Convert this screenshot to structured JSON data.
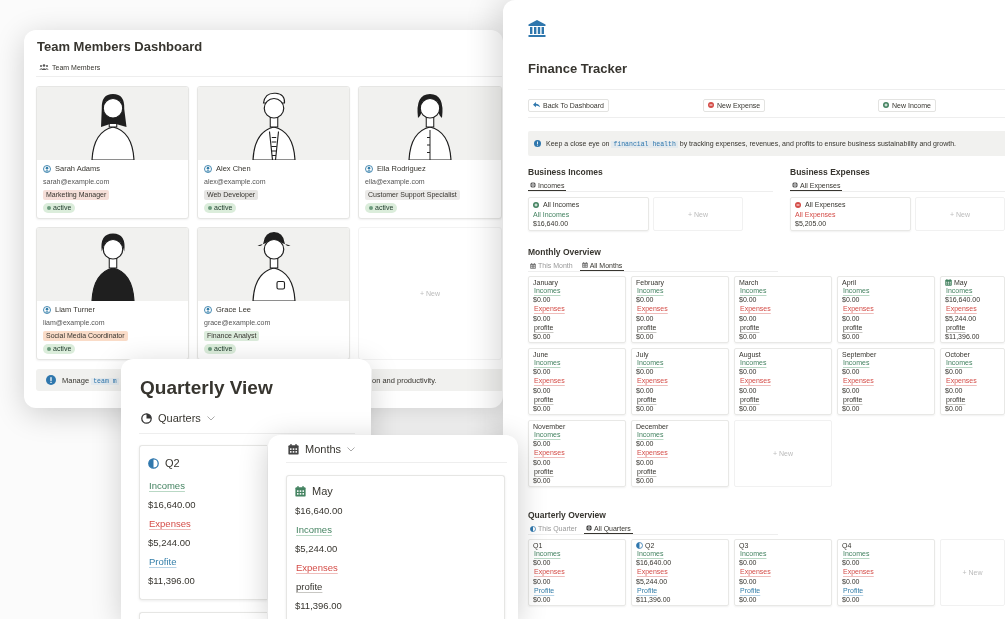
{
  "team_dashboard": {
    "title": "Team Members Dashboard",
    "view_tab": "Team Members",
    "members": [
      {
        "name": "Sarah Adams",
        "email": "sarah@example.com",
        "role": "Marketing Manager",
        "color": "#f6dfd9",
        "status": "active"
      },
      {
        "name": "Alex Chen",
        "email": "alex@example.com",
        "role": "Web Developer",
        "color": "#e6e5e3",
        "status": "active"
      },
      {
        "name": "Ella Rodriguez",
        "email": "ella@example.com",
        "role": "Customer Support Specialist",
        "color": "#ebeae8",
        "status": "active"
      },
      {
        "name": "Liam Turner",
        "email": "liam@example.com",
        "role": "Social Media Coordinator",
        "color": "#fadcc8",
        "status": "active"
      },
      {
        "name": "Grace Lee",
        "email": "grace@example.com",
        "role": "Finance Analyst",
        "color": "#dcecdc",
        "status": "active"
      }
    ],
    "new_card": "+ New",
    "callout": {
      "before": "Manage",
      "code": "team m",
      "after": "on and productivity."
    }
  },
  "finance_tracker": {
    "title": "Finance Tracker",
    "buttons": [
      {
        "label": "Back To Dashboard",
        "kind": "back"
      },
      {
        "label": "New Expense",
        "kind": "expense"
      },
      {
        "label": "New Income",
        "kind": "income"
      }
    ],
    "callout": {
      "before": "Keep a close eye on",
      "code": "financial health",
      "after": "by tracking expenses, revenues, and profits to ensure business sustainability and growth."
    },
    "sections": [
      {
        "kind": "income",
        "title": "Business Incomes",
        "view": "Incomes",
        "card": {
          "title": "All Incomes",
          "label": "All Incomes",
          "value": "$16,640.00"
        },
        "new": "+ New"
      },
      {
        "kind": "expense",
        "title": "Business Expenses",
        "view": "All Expenses",
        "card": {
          "title": "All Expenses",
          "label": "All Expenses",
          "value": "$5,205.00"
        },
        "new": "+ New"
      }
    ],
    "monthly": {
      "title": "Monthly Overview",
      "tabs": [
        {
          "label": "This Month",
          "selected": false
        },
        {
          "label": "All Months",
          "selected": true
        }
      ],
      "months": [
        {
          "name": "January",
          "current": false,
          "incomes_label": "Incomes",
          "incomes": "$0.00",
          "expenses_label": "Expenses",
          "expenses": "$0.00",
          "profit_label": "profite",
          "profit": "$0.00"
        },
        {
          "name": "February",
          "current": false,
          "incomes_label": "Incomes",
          "incomes": "$0.00",
          "expenses_label": "Expenses",
          "expenses": "$0.00",
          "profit_label": "profite",
          "profit": "$0.00"
        },
        {
          "name": "March",
          "current": false,
          "incomes_label": "Incomes",
          "incomes": "$0.00",
          "expenses_label": "Expenses",
          "expenses": "$0.00",
          "profit_label": "profite",
          "profit": "$0.00"
        },
        {
          "name": "April",
          "current": false,
          "incomes_label": "Incomes",
          "incomes": "$0.00",
          "expenses_label": "Expenses",
          "expenses": "$0.00",
          "profit_label": "profite",
          "profit": "$0.00"
        },
        {
          "name": "May",
          "current": true,
          "incomes_label": "Incomes",
          "incomes": "$16,640.00",
          "expenses_label": "Expenses",
          "expenses": "$5,244.00",
          "profit_label": "profite",
          "profit": "$11,396.00"
        },
        {
          "name": "June",
          "current": false,
          "incomes_label": "Incomes",
          "incomes": "$0.00",
          "expenses_label": "Expenses",
          "expenses": "$0.00",
          "profit_label": "profite",
          "profit": "$0.00"
        },
        {
          "name": "July",
          "current": false,
          "incomes_label": "Incomes",
          "incomes": "$0.00",
          "expenses_label": "Expenses",
          "expenses": "$0.00",
          "profit_label": "profite",
          "profit": "$0.00"
        },
        {
          "name": "August",
          "current": false,
          "incomes_label": "Incomes",
          "incomes": "$0.00",
          "expenses_label": "Expenses",
          "expenses": "$0.00",
          "profit_label": "profite",
          "profit": "$0.00"
        },
        {
          "name": "September",
          "current": false,
          "incomes_label": "Incomes",
          "incomes": "$0.00",
          "expenses_label": "Expenses",
          "expenses": "$0.00",
          "profit_label": "profite",
          "profit": "$0.00"
        },
        {
          "name": "October",
          "current": false,
          "incomes_label": "Incomes",
          "incomes": "$0.00",
          "expenses_label": "Expenses",
          "expenses": "$0.00",
          "profit_label": "profite",
          "profit": "$0.00"
        },
        {
          "name": "November",
          "current": false,
          "incomes_label": "Incomes",
          "incomes": "$0.00",
          "expenses_label": "Expenses",
          "expenses": "$0.00",
          "profit_label": "profite",
          "profit": "$0.00"
        },
        {
          "name": "December",
          "current": false,
          "incomes_label": "Incomes",
          "incomes": "$0.00",
          "expenses_label": "Expenses",
          "expenses": "$0.00",
          "profit_label": "profite",
          "profit": "$0.00"
        }
      ],
      "new": "+ New"
    },
    "quarterly": {
      "title": "Quarterly Overview",
      "tabs": [
        {
          "label": "This Quarter",
          "selected": false
        },
        {
          "label": "All Quarters",
          "selected": true
        }
      ],
      "quarters": [
        {
          "name": "Q1",
          "current": false,
          "incomes_label": "Incomes",
          "incomes": "$0.00",
          "expenses_label": "Expenses",
          "expenses": "$0.00",
          "profit_label": "Profite",
          "profit": "$0.00"
        },
        {
          "name": "Q2",
          "current": true,
          "incomes_label": "Incomes",
          "incomes": "$16,640.00",
          "expenses_label": "Expenses",
          "expenses": "$5,244.00",
          "profit_label": "Profite",
          "profit": "$11,396.00"
        },
        {
          "name": "Q3",
          "current": false,
          "incomes_label": "Incomes",
          "incomes": "$0.00",
          "expenses_label": "Expenses",
          "expenses": "$0.00",
          "profit_label": "Profite",
          "profit": "$0.00"
        },
        {
          "name": "Q4",
          "current": false,
          "incomes_label": "Incomes",
          "incomes": "$0.00",
          "expenses_label": "Expenses",
          "expenses": "$0.00",
          "profit_label": "Profite",
          "profit": "$0.00"
        }
      ],
      "new": "+ New"
    }
  },
  "quarterly_view": {
    "title": "Quarterly View",
    "view": "Quarters",
    "card": {
      "name": "Q2",
      "current": true,
      "lines": [
        {
          "kind": "income",
          "text": "Incomes"
        },
        {
          "kind": "value",
          "text": "$16,640.00"
        },
        {
          "kind": "expense",
          "text": "Expenses"
        },
        {
          "kind": "value",
          "text": "$5,244.00"
        },
        {
          "kind": "profit",
          "text": "Profite"
        },
        {
          "kind": "value",
          "text": "$11,396.00"
        }
      ]
    }
  },
  "months_view": {
    "view": "Months",
    "card": {
      "name": "May",
      "current": true,
      "lines": [
        {
          "kind": "value",
          "text": "$16,640.00"
        },
        {
          "kind": "income",
          "text": "Incomes"
        },
        {
          "kind": "value",
          "text": "$5,244.00"
        },
        {
          "kind": "expense",
          "text": "Expenses"
        },
        {
          "kind": "plain",
          "text": "profite"
        },
        {
          "kind": "value",
          "text": "$11,396.00"
        }
      ]
    }
  }
}
